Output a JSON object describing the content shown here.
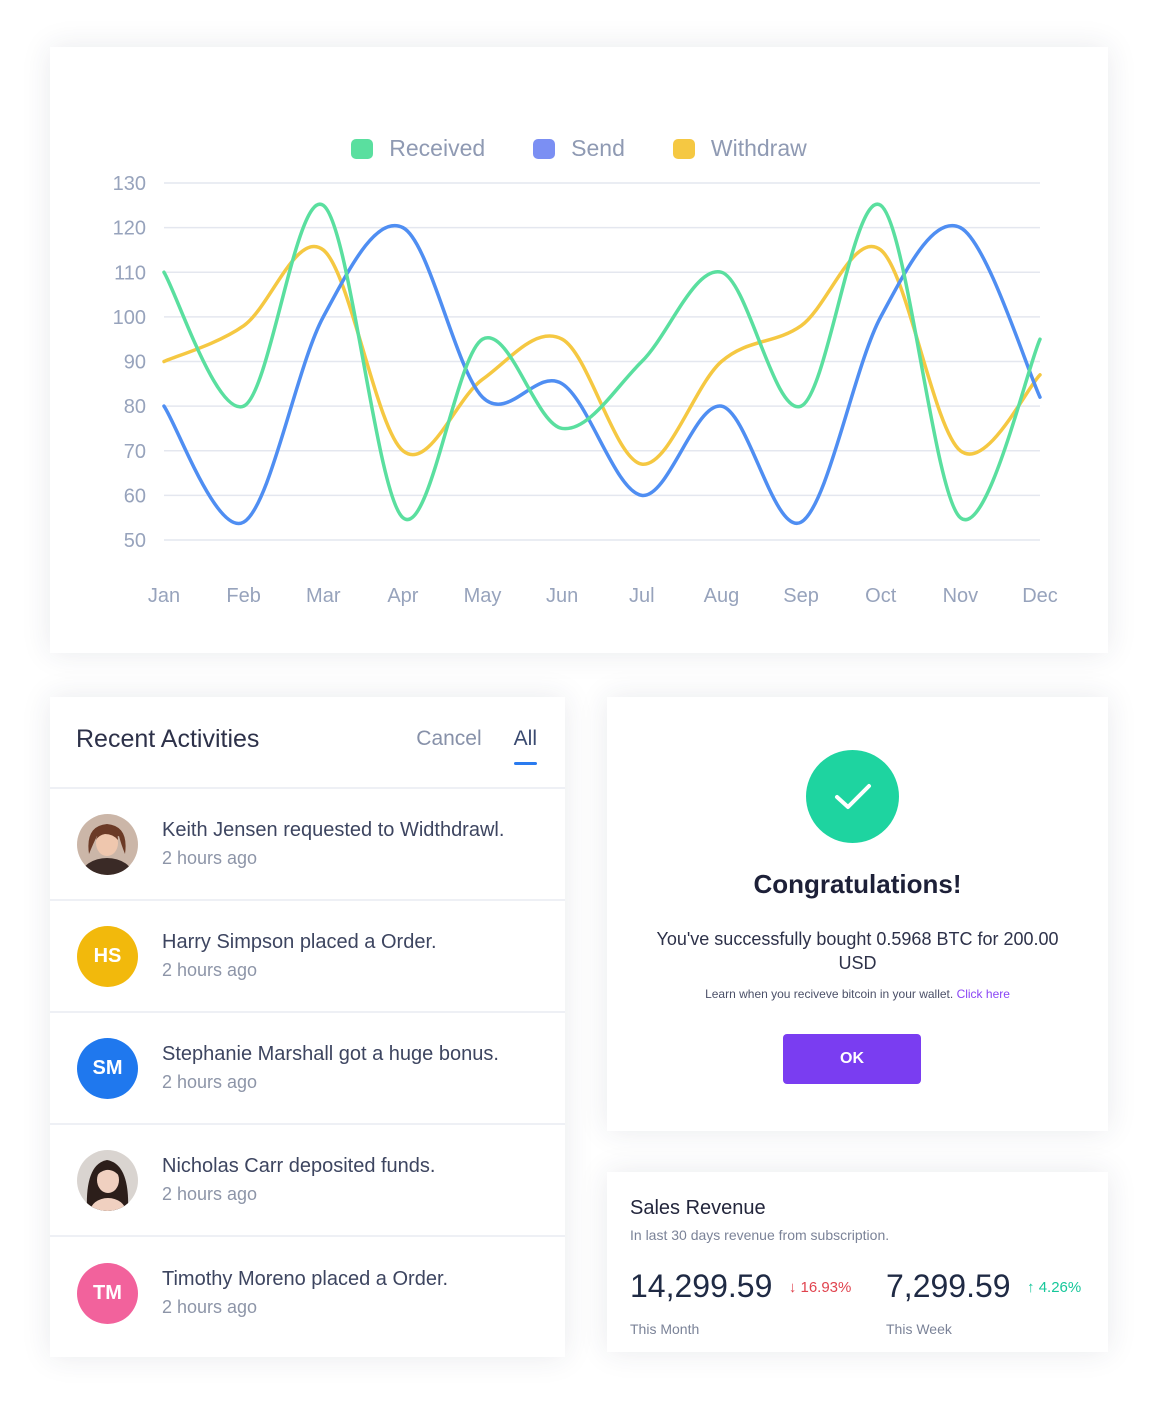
{
  "chart_data": {
    "type": "line",
    "categories": [
      "Jan",
      "Feb",
      "Mar",
      "Apr",
      "May",
      "Jun",
      "Jul",
      "Aug",
      "Sep",
      "Oct",
      "Nov",
      "Dec"
    ],
    "series": [
      {
        "name": "Received",
        "color": "#5adf9f",
        "values": [
          110,
          80,
          125,
          55,
          95,
          75,
          90,
          110,
          80,
          125,
          55,
          95
        ]
      },
      {
        "name": "Send",
        "color": "#4f8ef2",
        "values": [
          80,
          54,
          100,
          120,
          82,
          85,
          60,
          80,
          54,
          100,
          120,
          82
        ]
      },
      {
        "name": "Withdraw",
        "color": "#f5c842",
        "values": [
          90,
          98,
          115,
          70,
          86,
          95,
          67,
          90,
          98,
          115,
          70,
          87
        ]
      }
    ],
    "ylim": [
      50,
      130
    ],
    "yticks": [
      50,
      60,
      70,
      80,
      90,
      100,
      110,
      120,
      130
    ],
    "grid": true,
    "legend": "top-center"
  },
  "activities": {
    "title": "Recent Activities",
    "tabs": [
      {
        "label": "Cancel"
      },
      {
        "label": "All"
      }
    ],
    "items": [
      {
        "initials": "",
        "avatar_kind": "photo-woman",
        "message": "Keith Jensen requested to Widthdrawl.",
        "time": "2 hours ago"
      },
      {
        "initials": "HS",
        "color": "#f2b90c",
        "message": "Harry Simpson placed a Order.",
        "time": "2 hours ago"
      },
      {
        "initials": "SM",
        "color": "#1f78ee",
        "message": "Stephanie Marshall got a huge bonus.",
        "time": "2 hours ago"
      },
      {
        "initials": "",
        "avatar_kind": "photo-woman-dark",
        "message": "Nicholas Carr deposited funds.",
        "time": "2 hours ago"
      },
      {
        "initials": "TM",
        "color": "#f2629c",
        "message": "Timothy Moreno placed a Order.",
        "time": "2 hours ago"
      }
    ]
  },
  "congrats": {
    "title": "Congratulations!",
    "message": "You've successfully bought 0.5968 BTC for 200.00 USD",
    "note": "Learn when you reciveve bitcoin in your wallet.",
    "link": "Click here",
    "button": "OK",
    "accent": "#7a3df1",
    "check_color": "#1ed4a0"
  },
  "sales": {
    "title": "Sales Revenue",
    "subtitle": "In last 30 days revenue from subscription.",
    "month": {
      "value": "14,299.59",
      "change": "16.93%",
      "direction": "down",
      "label": "This Month"
    },
    "week": {
      "value": "7,299.59",
      "change": "4.26%",
      "direction": "up",
      "label": "This Week"
    }
  }
}
